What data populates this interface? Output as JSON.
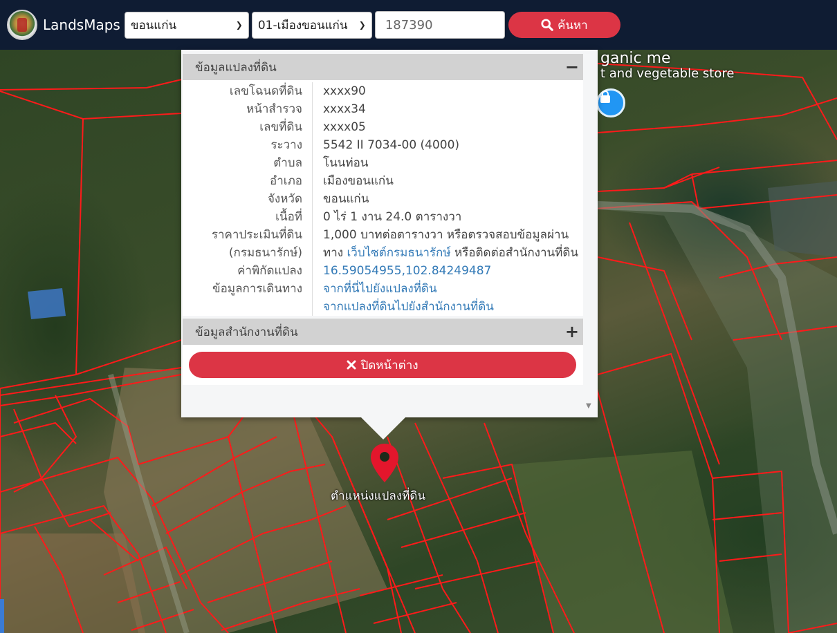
{
  "app": {
    "brand": "LandsMaps"
  },
  "search": {
    "province": "ขอนแก่น",
    "district": "01-เมืองขอนแก่น",
    "parcel_value": "187390",
    "button_label": "ค้นหา"
  },
  "map": {
    "poi_name": "ganic me",
    "poi_sub": "t and vegetable store",
    "marker_label": "ตำแหน่งแปลงที่ดิน"
  },
  "popup": {
    "land_panel_title": "ข้อมูลแปลงที่ดิน",
    "land_panel_toggle": "−",
    "rows": [
      {
        "label": "เลขโฉนดที่ดิน",
        "value": "xxxx90"
      },
      {
        "label": "หน้าสำรวจ",
        "value": "xxxx34"
      },
      {
        "label": "เลขที่ดิน",
        "value": "xxxx05"
      },
      {
        "label": "ระวาง",
        "value": "5542 II 7034-00 (4000)"
      },
      {
        "label": "ตำบล",
        "value": "โนนท่อน"
      },
      {
        "label": "อำเภอ",
        "value": "เมืองขอนแก่น"
      },
      {
        "label": "จังหวัด",
        "value": "ขอนแก่น"
      },
      {
        "label": "เนื้อที่",
        "value": "0 ไร่ 1 งาน 24.0 ตารางวา"
      }
    ],
    "price": {
      "label1": "ราคาประเมินที่ดิน",
      "label2": "(กรมธนารักษ์)",
      "line1": "1,000 บาทต่อตารางวา หรือตรวจสอบข้อมูลผ่าน",
      "line2_prefix": "ทาง",
      "line2_link": "เว็บไซต์กรมธนารักษ์",
      "line2_suffix": "หรือติดต่อสำนักงานที่ดิน"
    },
    "coord": {
      "label": "ค่าพิกัดแปลง",
      "value": "16.59054955,102.84249487"
    },
    "travel": {
      "label": "ข้อมูลการเดินทาง",
      "link1": "จากที่นี่ไปยังแปลงที่ดิน",
      "link2": "จากแปลงที่ดินไปยังสำนักงานที่ดิน"
    },
    "office_panel_title": "ข้อมูลสำนักงานที่ดิน",
    "office_panel_toggle": "+",
    "close_label": "ปิดหน้าต่าง"
  }
}
